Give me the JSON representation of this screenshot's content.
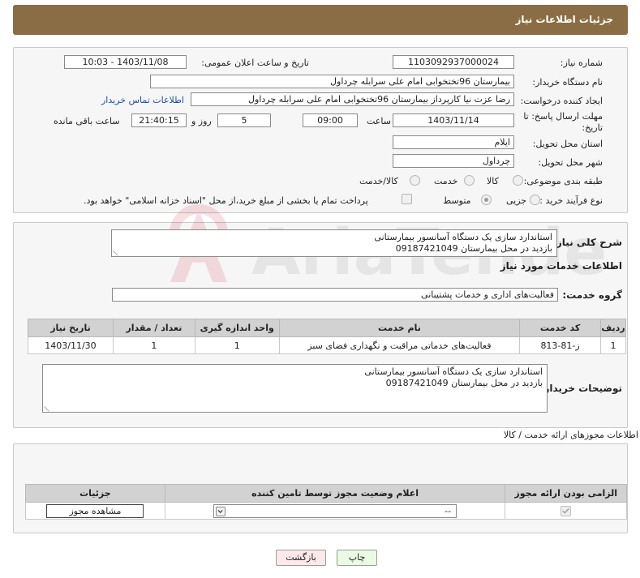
{
  "header": {
    "title": "جزئیات اطلاعات نیاز"
  },
  "fields": {
    "need_number_label": "شماره نیاز:",
    "need_number": "1103092937000024",
    "announce_label": "تاریخ و ساعت اعلان عمومی:",
    "announce_value": "1403/11/08 - 10:03",
    "buyer_org_label": "نام دستگاه خریدار:",
    "buyer_org": "بیمارستان 96تختخوابی امام علی سرابله چرداول",
    "creator_label": "ایجاد کننده درخواست:",
    "creator": "رضا عزت نیا کارپرداز بیمارستان 96تختخوابی امام علی سرابله چرداول",
    "contact_link": "اطلاعات تماس خریدار",
    "deadline_label": "مهلت ارسال پاسخ: تا تاریخ:",
    "deadline_date": "1403/11/14",
    "time_label": "ساعت",
    "deadline_time": "09:00",
    "days_value": "5",
    "days_label": "روز و",
    "remaining_time": "21:40:15",
    "remaining_label": "ساعت باقی مانده",
    "province_label": "استان محل تحویل:",
    "province": "ایلام",
    "city_label": "شهر محل تحویل:",
    "city": "چرداول",
    "category_label": "طبقه بندی موضوعی:",
    "category_options": [
      "کالا",
      "خدمت",
      "کالا/خدمت"
    ],
    "process_label": "نوع فرآیند خرید :",
    "process_options": [
      "جزیی",
      "متوسط"
    ],
    "payment_note": "پرداخت تمام یا بخشی از مبلغ خرید،از محل \"اسناد خزانه اسلامی\" خواهد بود."
  },
  "summary": {
    "label": "شرح کلی نیاز:",
    "text": "استاندارد سازی یک دستگاه آسانسور بیمارستانی\nبازدید در محل بیمارستان 09187421049"
  },
  "services": {
    "section_title": "اطلاعات خدمات مورد نیاز",
    "group_label": "گروه خدمت:",
    "group_value": "فعالیت‌های اداری و خدمات پشتیبانی",
    "columns": [
      "ردیف",
      "کد خدمت",
      "نام خدمت",
      "واحد اندازه گیری",
      "تعداد / مقدار",
      "تاریخ نیاز"
    ],
    "rows": [
      [
        "1",
        "ز-81-813",
        "فعالیت‌های خدماتی مراقبت و نگهداری فضای سبز",
        "1",
        "1",
        "1403/11/30"
      ]
    ]
  },
  "buyer_notes": {
    "label": "توضیحات خریدار:",
    "text": "استاندارد سازی یک دستگاه آسانسور بیمارستانی\nبازدید در محل بیمارستان 09187421049"
  },
  "permits": {
    "section_title": "اطلاعات مجوزهای ارائه خدمت / کالا",
    "columns": [
      "الزامی بودن ارائه مجوز",
      "اعلام وضعیت مجوز توسط تامین کننده",
      "جزئیات"
    ],
    "select_value": "--",
    "view_button": "مشاهده مجوز"
  },
  "actions": {
    "print": "چاپ",
    "back": "بازگشت"
  },
  "watermark": {
    "text": "AriaTender.neT"
  }
}
